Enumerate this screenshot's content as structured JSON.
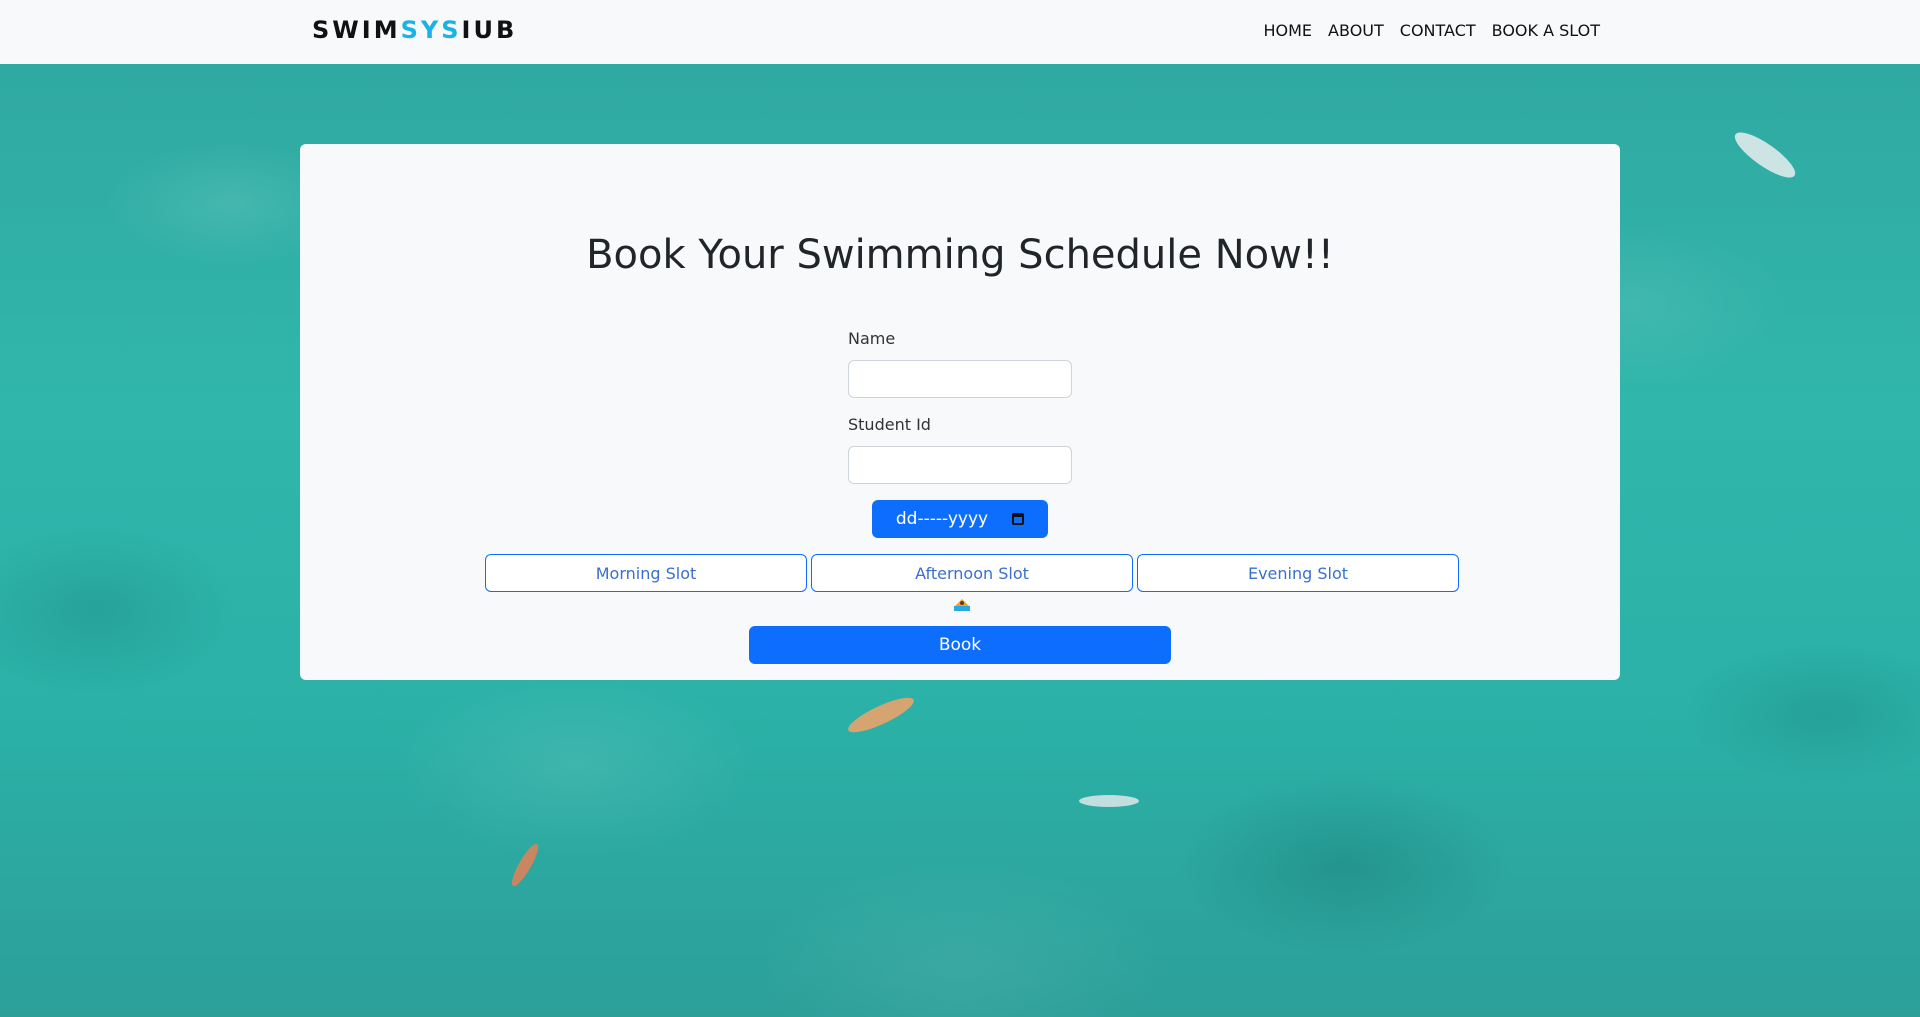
{
  "brand": {
    "part1": "SWIM",
    "part2": "SYS",
    "part3": "IUB"
  },
  "nav": {
    "items": [
      "HOME",
      "ABOUT",
      "CONTACT",
      "BOOK A SLOT"
    ]
  },
  "form": {
    "title": "Book Your Swimming Schedule Now!!",
    "name_label": "Name",
    "name_value": "",
    "student_id_label": "Student Id",
    "student_id_value": "",
    "date_placeholder": "dd-----yyyy",
    "slots": [
      "Morning Slot",
      "Afternoon Slot",
      "Evening Slot"
    ],
    "slot_icon": "swimmer-icon",
    "book_label": "Book"
  },
  "colors": {
    "brand_accent": "#1ab2e8",
    "primary": "#0d6efd",
    "navbar_bg": "#f8f9fa",
    "water": "#31b6ab"
  }
}
